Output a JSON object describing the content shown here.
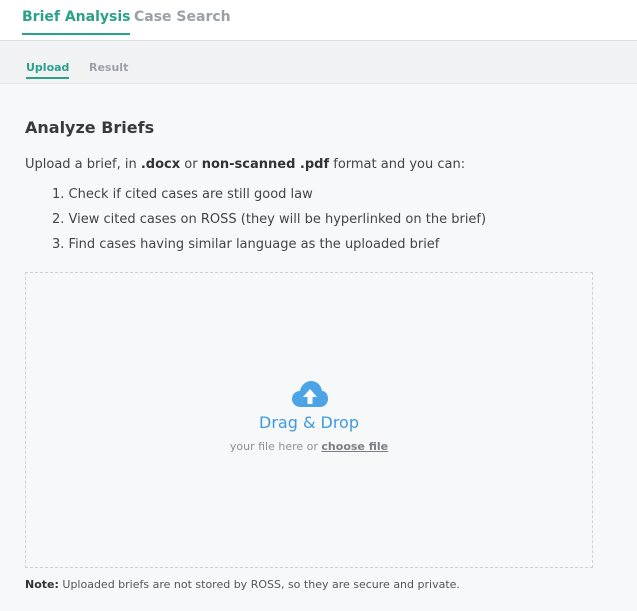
{
  "tabs": {
    "brief_analysis": "Brief Analysis",
    "case_search": "Case Search"
  },
  "subtabs": {
    "upload": "Upload",
    "result": "Result"
  },
  "main": {
    "title": "Analyze Briefs",
    "intro_prefix": "Upload a brief, in ",
    "intro_docx": ".docx",
    "intro_or": " or ",
    "intro_pdf": "non-scanned .pdf",
    "intro_suffix": " format and you can:",
    "steps": [
      "1. Check if cited cases are still good law",
      "2. View cited cases on ROSS (they will be hyperlinked on the brief)",
      "3. Find cases having similar language as the uploaded brief"
    ]
  },
  "dropzone": {
    "title": "Drag & Drop",
    "sub_prefix": "your file here or ",
    "choose_link": "choose file",
    "icon": "cloud-upload-icon"
  },
  "note": {
    "label": "Note:",
    "text": " Uploaded briefs are not stored by ROSS, so they are secure and private."
  },
  "colors": {
    "accent": "#2ba18a",
    "upload_blue": "#3d9ae0"
  }
}
